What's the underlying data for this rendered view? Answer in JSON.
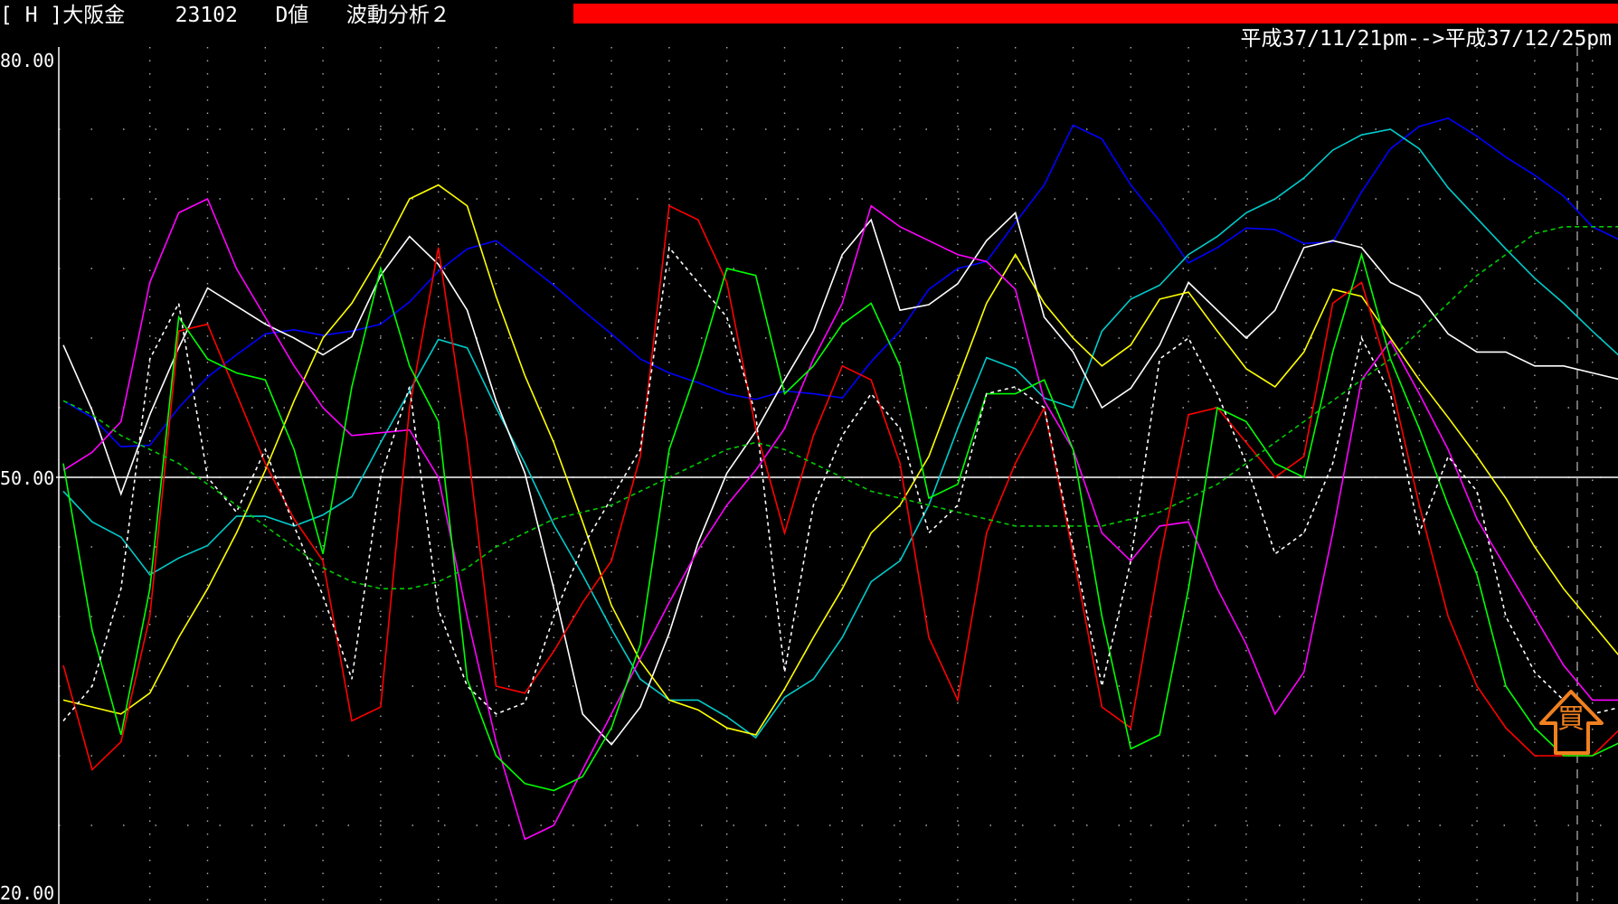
{
  "header": {
    "bracket": "[ H ]",
    "instrument": "大阪金",
    "code": "23102",
    "mode": "D値",
    "analysis": "波動分析２",
    "date_range": "平成37/11/21pm-->平成37/12/25pm"
  },
  "colors": {
    "background": "#000000",
    "progress_bar": "#ff0000",
    "buy_marker": "#f08020"
  },
  "buy_marker": {
    "label": "買",
    "icon": "up-arrow-icon"
  },
  "chart_data": {
    "type": "line",
    "ylim": [
      20,
      80
    ],
    "yticks": [
      "80.00",
      "50.00",
      "20.00"
    ],
    "reference_line": 50,
    "grid": true,
    "x_count": 55,
    "series": [
      {
        "color": "#0000ff",
        "style": "solid",
        "values": [
          55.5,
          54.3,
          52.2,
          52.3,
          55.0,
          57.2,
          58.8,
          60.3,
          60.6,
          60.2,
          60.5,
          61.0,
          62.6,
          64.8,
          66.4,
          67.0,
          65.4,
          63.8,
          62.0,
          60.3,
          58.5,
          57.5,
          56.8,
          56.0,
          55.6,
          56.2,
          56.0,
          55.7,
          58.3,
          60.5,
          63.5,
          65.0,
          65.5,
          68.3,
          71.0,
          75.3,
          74.3,
          71.0,
          68.4,
          65.4,
          66.5,
          67.9,
          67.8,
          66.8,
          66.9,
          70.5,
          73.6,
          75.2,
          75.8,
          74.5,
          73.0,
          71.7,
          70.2,
          68.0,
          67.0
        ]
      },
      {
        "color": "#00cccc",
        "style": "solid",
        "values": [
          49.0,
          46.8,
          45.7,
          43.0,
          44.2,
          45.1,
          47.2,
          47.2,
          46.5,
          47.3,
          48.6,
          52.5,
          56.2,
          59.9,
          59.3,
          55.0,
          51.0,
          46.6,
          43.0,
          39.1,
          35.5,
          34.0,
          34.0,
          32.8,
          31.3,
          34.2,
          35.5,
          38.5,
          42.5,
          44.0,
          48.0,
          53.5,
          58.6,
          57.8,
          55.7,
          55.0,
          60.5,
          62.8,
          63.8,
          66.0,
          67.3,
          69.0,
          70.0,
          71.5,
          73.5,
          74.6,
          75.0,
          73.6,
          70.8,
          68.6,
          66.4,
          64.3,
          62.5,
          60.5,
          58.6
        ]
      },
      {
        "color": "#ffffff",
        "style": "solid",
        "values": [
          59.5,
          54.8,
          48.8,
          54.5,
          59.3,
          63.6,
          62.3,
          61.0,
          60.0,
          58.8,
          60.1,
          64.5,
          67.3,
          65.3,
          62.0,
          55.5,
          50.3,
          42.0,
          33.0,
          30.8,
          33.5,
          38.8,
          45.3,
          50.3,
          53.3,
          57.0,
          60.5,
          66.0,
          68.5,
          62.0,
          62.4,
          63.9,
          67.0,
          69.0,
          61.5,
          59.0,
          55.0,
          56.4,
          59.5,
          64.0,
          62.0,
          60.0,
          62.0,
          66.5,
          67.0,
          66.5,
          64.0,
          63.0,
          60.3,
          59.0,
          59.0,
          58.0,
          58.0,
          57.5,
          57.0
        ]
      },
      {
        "color": "#ffff00",
        "style": "solid",
        "values": [
          34.0,
          33.5,
          33.0,
          34.5,
          38.5,
          42.0,
          46.0,
          50.5,
          55.5,
          60.0,
          62.5,
          66.0,
          70.0,
          71.0,
          69.5,
          63.0,
          57.3,
          52.5,
          46.8,
          40.8,
          36.8,
          34.0,
          33.3,
          32.0,
          31.5,
          34.8,
          38.5,
          42.0,
          46.0,
          48.0,
          51.5,
          57.0,
          62.5,
          66.0,
          62.5,
          60.0,
          58.0,
          59.5,
          62.8,
          63.3,
          60.5,
          57.8,
          56.5,
          59.0,
          63.5,
          63.0,
          60.0,
          57.0,
          54.3,
          51.5,
          48.5,
          45.0,
          42.0,
          39.5,
          37.0
        ]
      },
      {
        "color": "#ff00ff",
        "style": "solid",
        "values": [
          50.5,
          51.8,
          54.0,
          64.0,
          69.0,
          70.0,
          65.0,
          61.5,
          58.0,
          55.0,
          53.0,
          53.2,
          53.4,
          50.0,
          40.0,
          31.0,
          24.0,
          25.0,
          29.0,
          33.0,
          37.0,
          41.0,
          44.8,
          48.0,
          50.5,
          53.5,
          58.5,
          62.5,
          69.5,
          68.0,
          67.0,
          66.0,
          65.5,
          63.5,
          55.5,
          52.0,
          46.0,
          44.0,
          46.5,
          46.8,
          42.0,
          38.0,
          33.0,
          36.0,
          46.0,
          57.0,
          59.8,
          56.0,
          52.0,
          47.0,
          43.5,
          40.0,
          36.5,
          34.0,
          34.0
        ]
      },
      {
        "color": "#ff0000",
        "style": "solid",
        "values": [
          36.5,
          29.0,
          31.0,
          40.0,
          60.5,
          61.0,
          56.0,
          51.0,
          47.0,
          44.0,
          32.5,
          33.5,
          55.0,
          66.5,
          52.5,
          35.0,
          34.5,
          37.5,
          41.0,
          44.0,
          51.5,
          69.5,
          68.5,
          64.0,
          53.5,
          46.0,
          53.0,
          58.0,
          57.0,
          51.0,
          38.5,
          34.0,
          46.0,
          51.0,
          55.0,
          44.5,
          33.5,
          32.0,
          44.0,
          54.5,
          55.0,
          52.5,
          50.0,
          51.5,
          62.5,
          64.0,
          57.0,
          48.0,
          40.0,
          35.0,
          32.0,
          30.0,
          30.0,
          30.0,
          32.0
        ]
      },
      {
        "color": "#00ff00",
        "style": "solid",
        "values": [
          51.0,
          39.0,
          31.5,
          42.0,
          61.5,
          58.5,
          57.5,
          57.0,
          52.0,
          44.5,
          56.5,
          65.0,
          58.0,
          54.0,
          35.5,
          30.0,
          28.0,
          27.5,
          28.5,
          32.0,
          38.0,
          52.0,
          58.0,
          65.0,
          64.5,
          56.0,
          58.0,
          61.0,
          62.5,
          58.0,
          48.5,
          49.5,
          56.0,
          56.0,
          57.0,
          52.0,
          40.0,
          30.5,
          31.5,
          42.0,
          55.0,
          54.0,
          51.0,
          50.0,
          59.0,
          66.0,
          58.5,
          53.5,
          48.0,
          43.0,
          35.0,
          32.0,
          30.0,
          30.0,
          31.0
        ]
      },
      {
        "color": "#ffffff",
        "style": "dotted",
        "values": [
          32.5,
          35.0,
          42.0,
          58.5,
          62.5,
          50.0,
          47.5,
          52.0,
          46.5,
          41.5,
          35.5,
          50.0,
          56.5,
          40.5,
          35.0,
          33.0,
          33.8,
          40.0,
          45.0,
          48.5,
          52.0,
          66.5,
          64.0,
          61.5,
          54.5,
          36.0,
          48.0,
          53.0,
          56.0,
          53.5,
          46.0,
          48.0,
          56.0,
          56.5,
          55.0,
          45.0,
          35.0,
          44.0,
          58.5,
          60.0,
          56.0,
          51.0,
          44.5,
          46.0,
          51.0,
          60.0,
          56.0,
          46.0,
          51.5,
          49.0,
          40.0,
          36.0,
          34.0,
          33.0,
          33.5
        ]
      },
      {
        "color": "#00cc00",
        "style": "dashed",
        "values": [
          55.5,
          54.5,
          53.0,
          52.0,
          51.0,
          49.5,
          48.0,
          46.5,
          45.0,
          43.5,
          42.5,
          42.0,
          42.0,
          42.5,
          43.5,
          45.0,
          46.0,
          47.0,
          47.5,
          48.0,
          49.0,
          50.0,
          51.0,
          52.0,
          52.5,
          52.0,
          51.0,
          50.0,
          49.0,
          48.5,
          48.0,
          47.5,
          47.0,
          46.5,
          46.5,
          46.5,
          46.5,
          47.0,
          47.5,
          48.5,
          49.5,
          51.0,
          52.5,
          54.0,
          55.5,
          57.0,
          58.5,
          60.5,
          62.5,
          64.5,
          66.0,
          67.5,
          68.0,
          68.0,
          68.0
        ]
      }
    ]
  }
}
